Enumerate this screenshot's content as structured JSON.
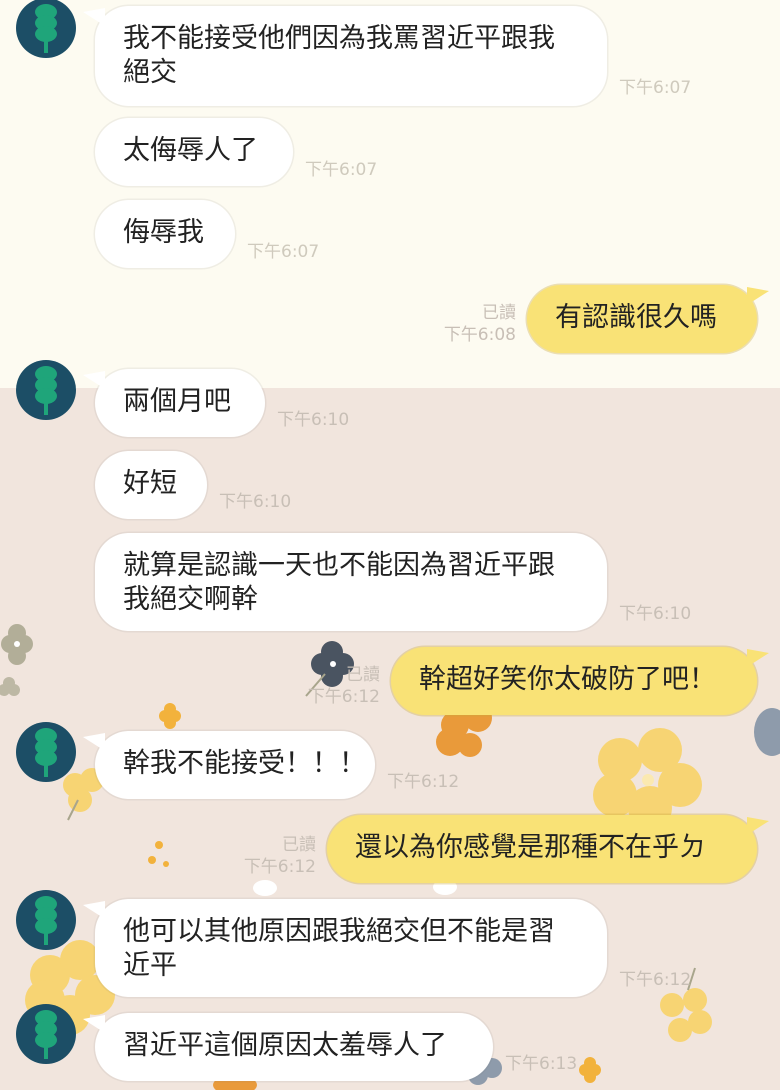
{
  "messages": [
    {
      "side": "in",
      "text_lines": [
        "我不能接受他們因為我罵習近平跟我",
        "絕交"
      ],
      "time": "下午6:07"
    },
    {
      "side": "in",
      "text_lines": [
        "太侮辱人了"
      ],
      "time": "下午6:07"
    },
    {
      "side": "in",
      "text_lines": [
        "侮辱我"
      ],
      "time": "下午6:07"
    },
    {
      "side": "out",
      "text_lines": [
        "有認識很久嗎"
      ],
      "read": "已讀",
      "time": "下午6:08"
    },
    {
      "side": "in",
      "text_lines": [
        "兩個月吧"
      ],
      "time": "下午6:10"
    },
    {
      "side": "in",
      "text_lines": [
        "好短"
      ],
      "time": "下午6:10"
    },
    {
      "side": "in",
      "text_lines": [
        "就算是認識一天也不能因為習近平跟",
        "我絕交啊幹"
      ],
      "time": "下午6:10"
    },
    {
      "side": "out",
      "text_lines": [
        "幹超好笑你太破防了吧！"
      ],
      "read": "已讀",
      "time": "下午6:12"
    },
    {
      "side": "in",
      "text_lines": [
        "幹我不能接受！！！"
      ],
      "time": "下午6:12"
    },
    {
      "side": "out",
      "text_lines": [
        "還以為你感覺是那種不在乎ㄉ"
      ],
      "read": "已讀",
      "time": "下午6:12"
    },
    {
      "side": "in",
      "text_lines": [
        "他可以其他原因跟我絕交但不能是習",
        "近平"
      ],
      "time": "下午6:12"
    },
    {
      "side": "in",
      "text_lines": [
        "習近平這個原因太羞辱人了"
      ],
      "time": "下午6:13"
    }
  ],
  "colors": {
    "incoming_bubble": "#ffffff",
    "outgoing_bubble": "#f9e276",
    "avatar_bg": "#1c4e66",
    "avatar_icon": "#1fa57a",
    "bg_top": "#fdfbf1",
    "bg_bottom": "#f1e5dd"
  },
  "icons": {
    "avatar": "green-stacked-circles-avatar-icon",
    "decorations": "flower-pattern"
  }
}
